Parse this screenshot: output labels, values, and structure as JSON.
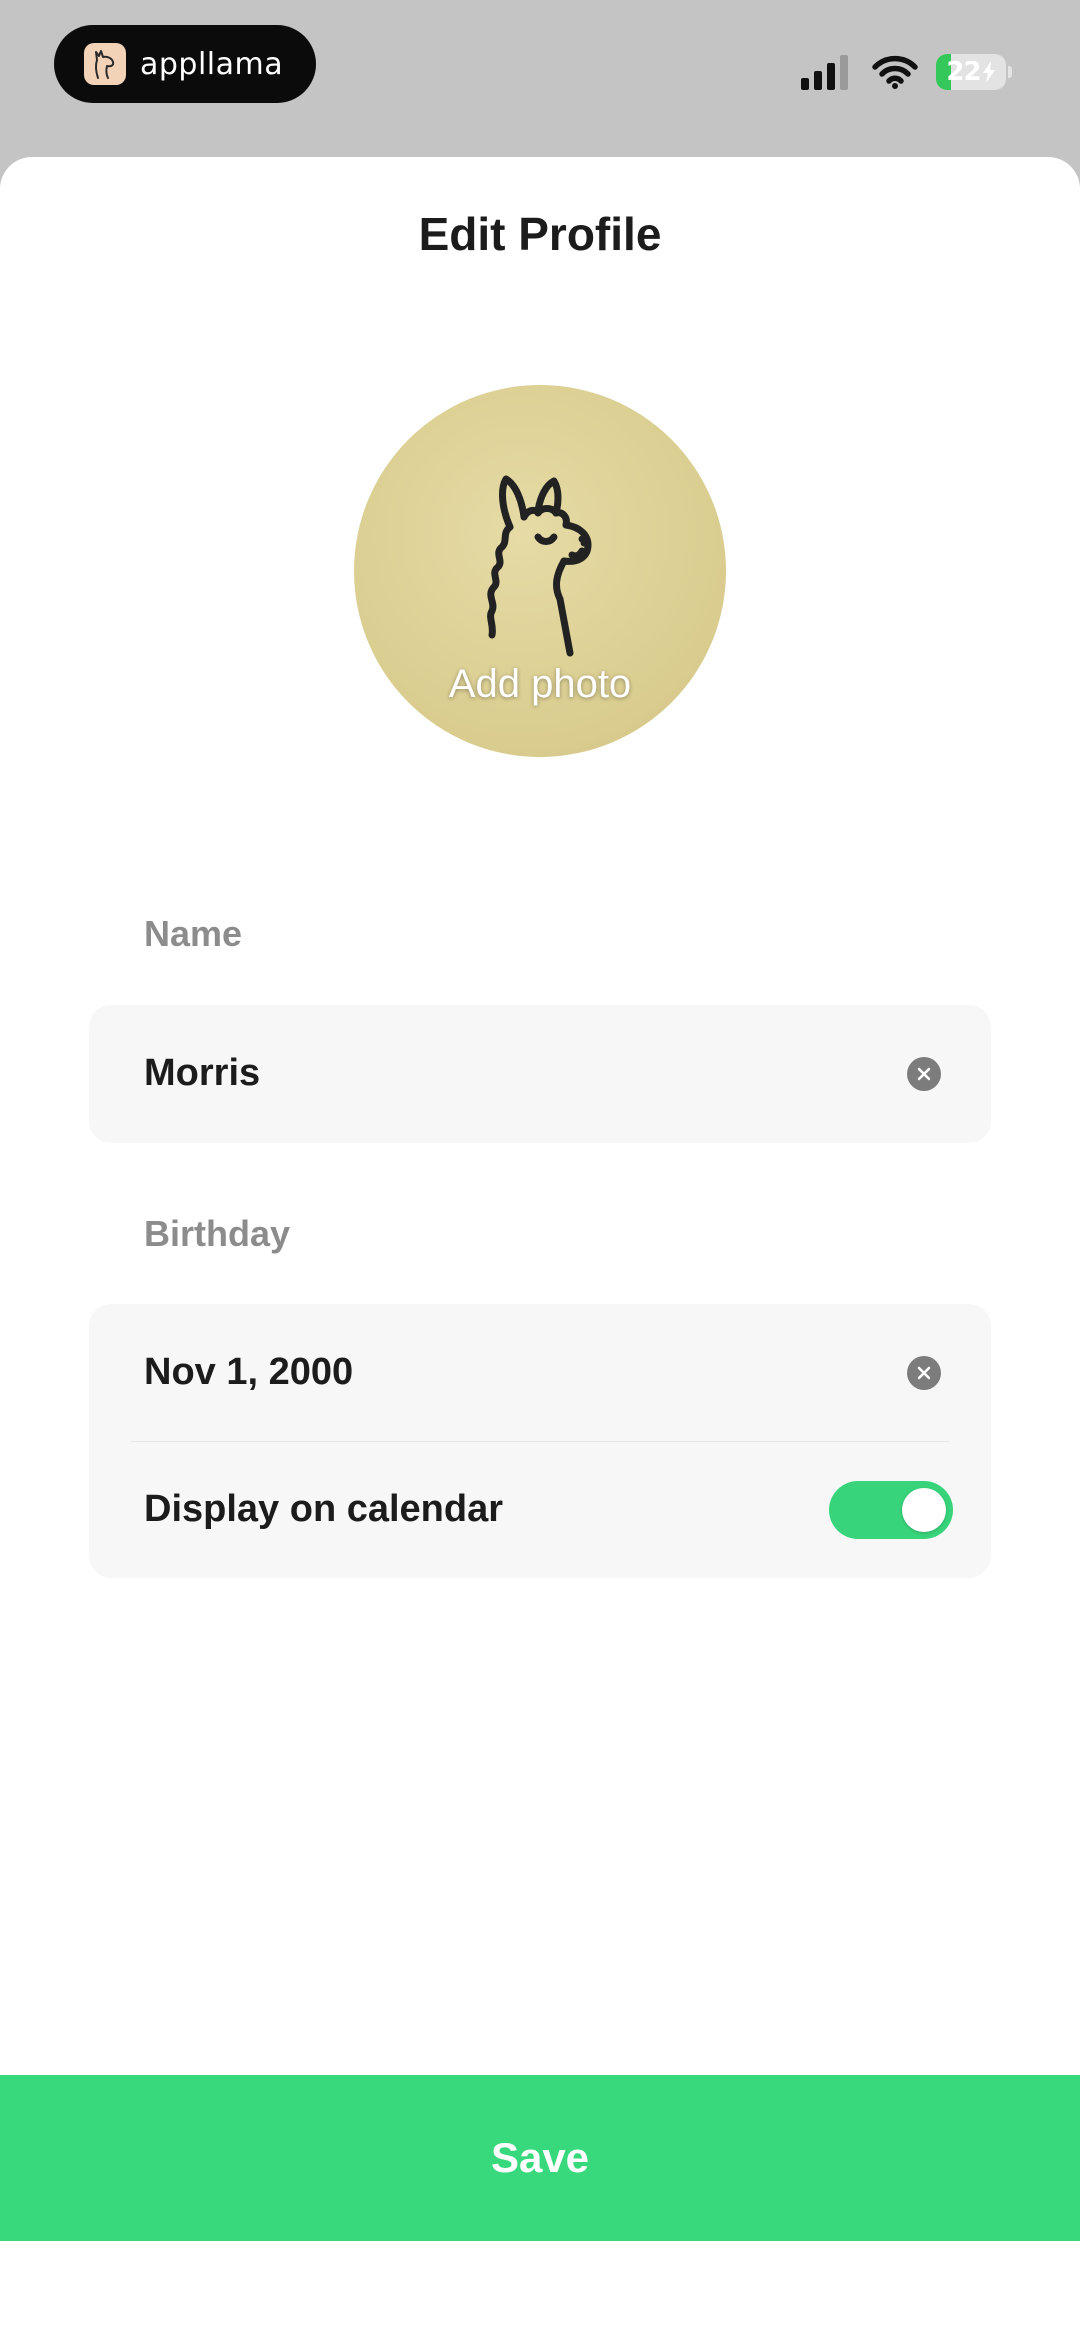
{
  "status_bar": {
    "app_pill_name": "appllama",
    "battery_level": "22",
    "battery_charging": true,
    "battery_percent": 22,
    "signal_bars_filled": 3,
    "signal_bars_total": 4
  },
  "sheet": {
    "title": "Edit Profile",
    "avatar": {
      "label": "Add photo",
      "icon": "llama-icon"
    },
    "name_field": {
      "label": "Name",
      "value": "Morris"
    },
    "birthday_field": {
      "label": "Birthday",
      "value": "Nov 1, 2000",
      "display_on_calendar_label": "Display on calendar",
      "display_on_calendar_enabled": true
    },
    "save_label": "Save"
  },
  "colors": {
    "accent_green": "#38d87c",
    "toggle_on": "#38d47b",
    "avatar_bg": "#dcd095",
    "status_bar_bg": "#c4c4c4",
    "card_bg": "#f7f7f7",
    "label_gray": "#8c8c8c"
  }
}
